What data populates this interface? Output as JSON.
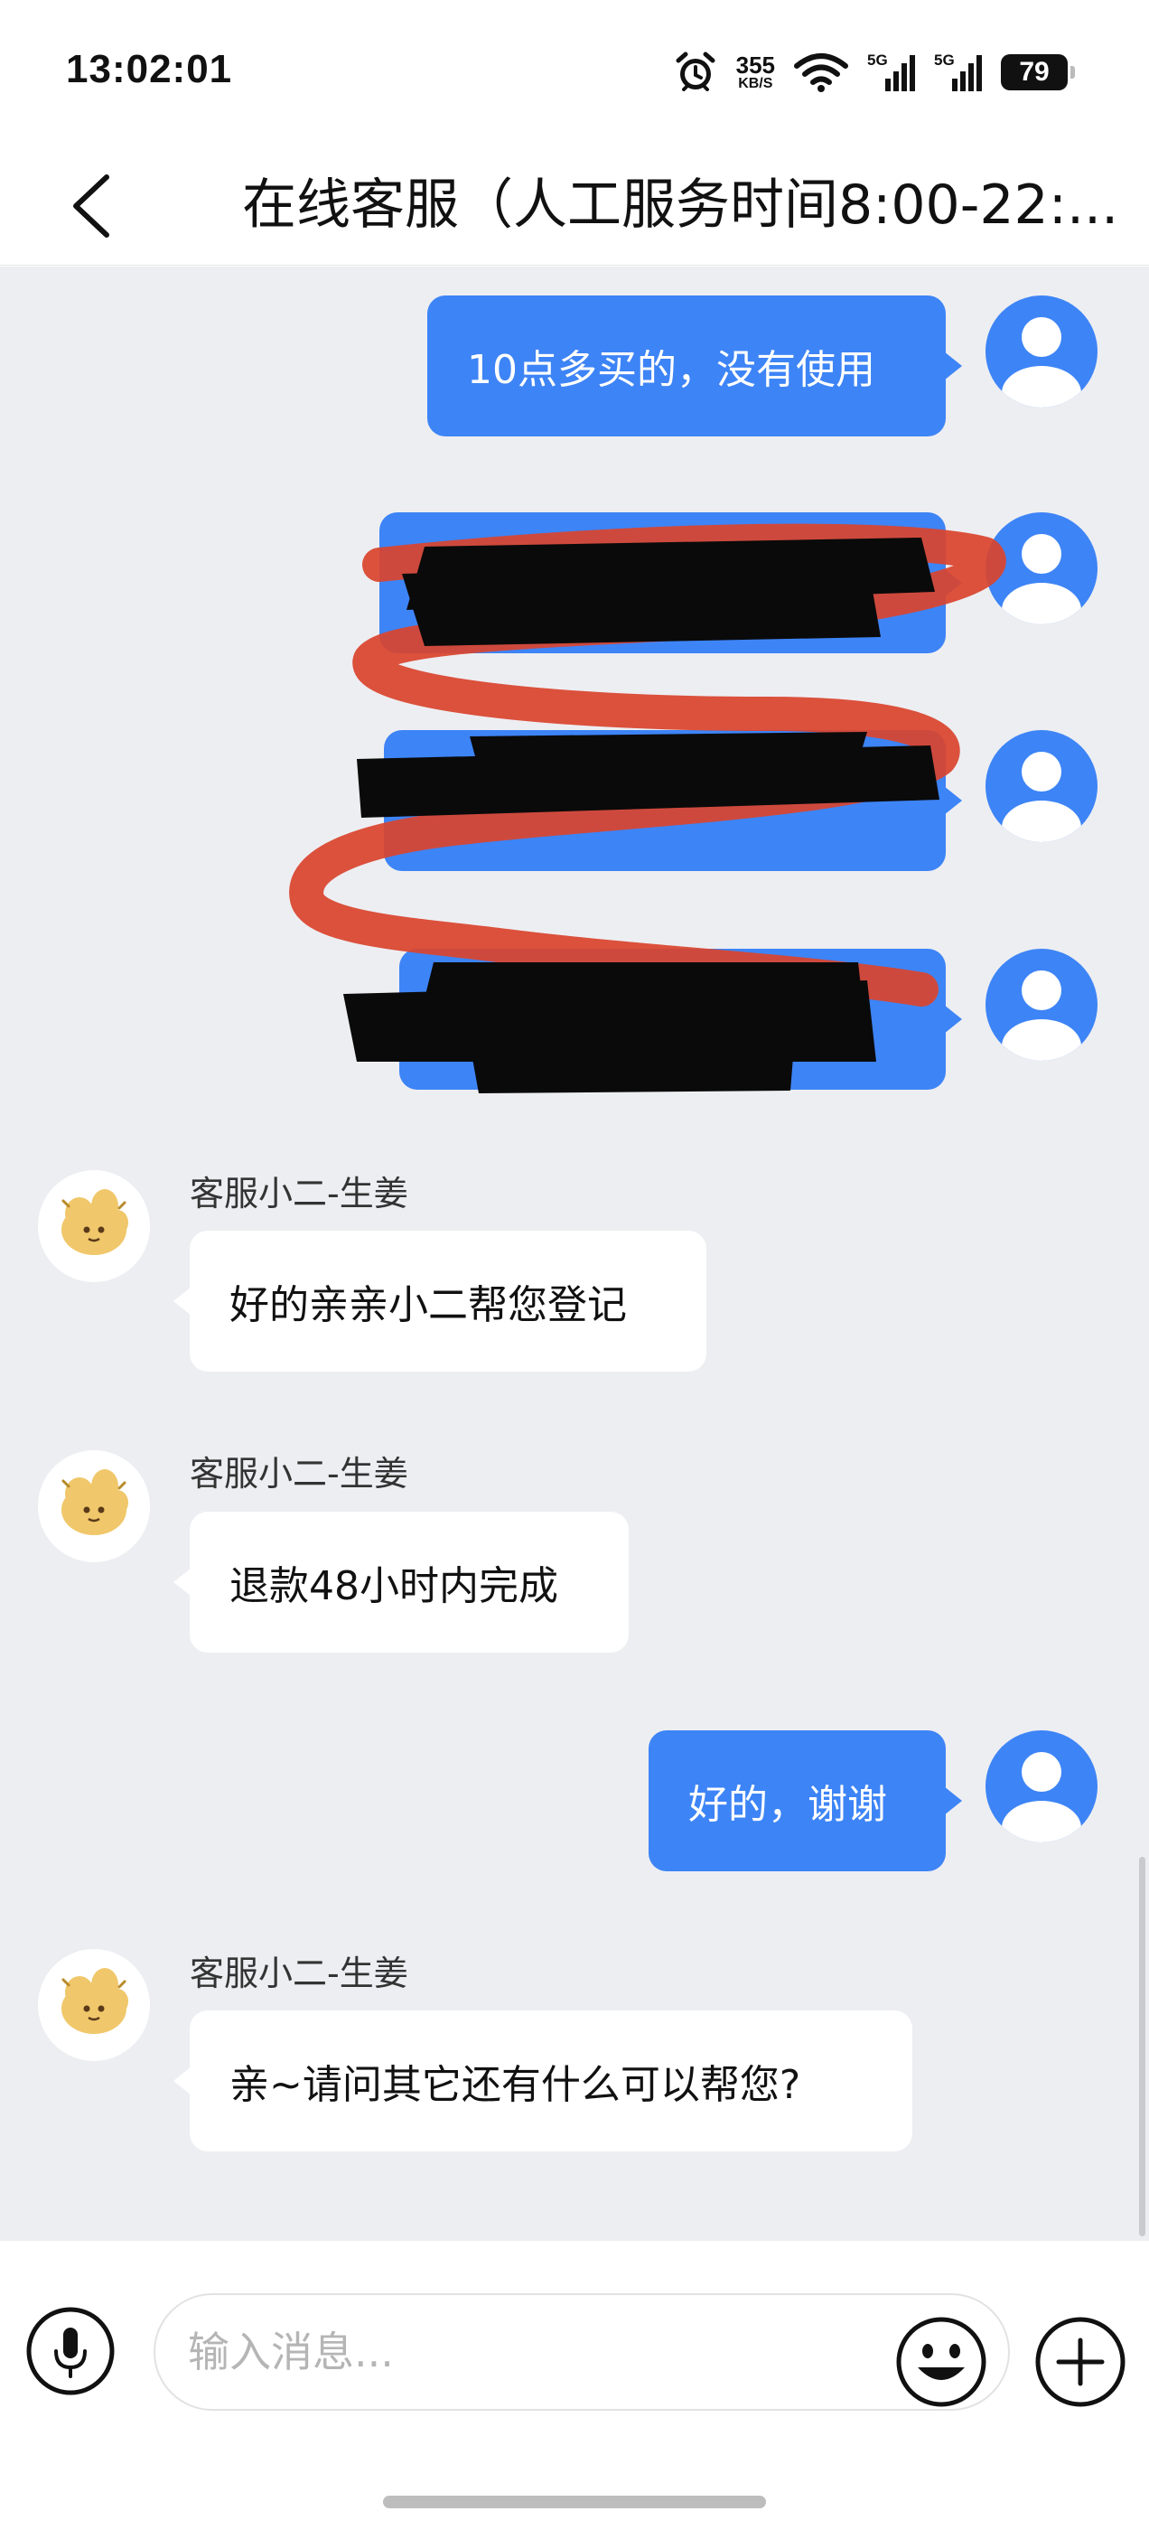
{
  "status_bar": {
    "time": "13:02:01",
    "net_speed": "355",
    "net_speed_unit": "KB/S",
    "signal_tag_1": "5G",
    "signal_tag_2": "5G",
    "battery": "79",
    "icons": [
      "alarm-icon",
      "wifi-icon",
      "signal-icon",
      "battery-icon"
    ]
  },
  "header": {
    "back_icon": "chevron-left-icon",
    "title": "在线客服（人工服务时间8:00-22:..."
  },
  "messages": [
    {
      "from": "user",
      "text": "10点多买的，没有使用"
    },
    {
      "from": "user",
      "text": "",
      "redacted": true
    },
    {
      "from": "user",
      "text": "",
      "redacted": true
    },
    {
      "from": "user",
      "text": "",
      "redacted": true
    },
    {
      "from": "agent",
      "sender": "客服小二-生姜",
      "text": "好的亲亲小二帮您登记"
    },
    {
      "from": "agent",
      "sender": "客服小二-生姜",
      "text": "退款48小时内完成"
    },
    {
      "from": "user",
      "text": "好的，谢谢"
    },
    {
      "from": "agent",
      "sender": "客服小二-生姜",
      "text": "亲~请问其它还有什么可以帮您?"
    }
  ],
  "input_bar": {
    "placeholder": "输入消息...",
    "icons": [
      "microphone-icon",
      "emoji-icon",
      "plus-icon"
    ]
  },
  "colors": {
    "accent": "#3d84f6",
    "chat_background": "#edeef2",
    "redaction_black": "#0a0a0a",
    "redaction_red": "#d9452e"
  }
}
